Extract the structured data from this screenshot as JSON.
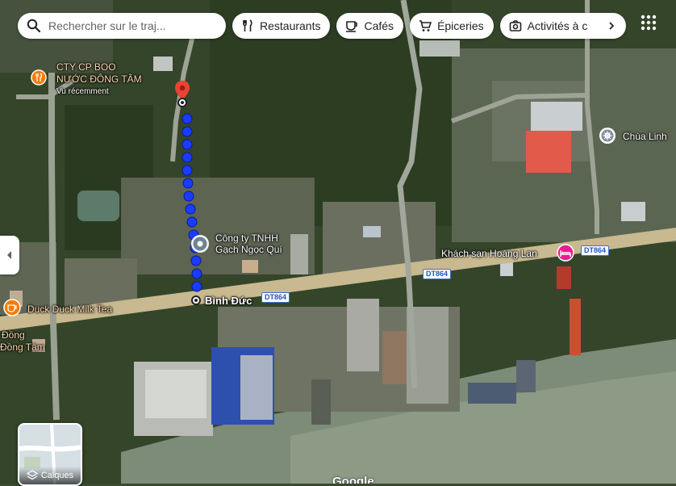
{
  "search": {
    "placeholder": "Rechercher sur le traj..."
  },
  "chips": [
    {
      "label": "Restaurants",
      "icon": "fork-knife-icon"
    },
    {
      "label": "Cafés",
      "icon": "coffee-cup-icon"
    },
    {
      "label": "Épiceries",
      "icon": "shopping-cart-icon"
    },
    {
      "label": "Activités à c",
      "icon": "camera-icon"
    }
  ],
  "places": {
    "cty_line1": "CTY CP BOO",
    "cty_line2": "NƯỚC ĐÔNG TÂM",
    "cty_sub": "Vu récemment",
    "chua": "Chùa Linh",
    "tnhh_line1": "Công ty TNHH",
    "tnhh_line2": "Gạch Ngọc Quí",
    "hotel": "Khách sạn Hoàng Lan",
    "binh_duc": "Bình Đức",
    "milk_tea": "Duck Duck Milk Tea",
    "dong_line1": "Đồng",
    "dong_line2": "Đồng Tâm"
  },
  "road_shields": [
    "DT864",
    "DT864",
    "DT864"
  ],
  "layers_label": "Calques",
  "watermark": "Google",
  "colors": {
    "route_blue": "#1a3cff",
    "pin_red": "#ea4335",
    "restaurant_orange": "#f57c00",
    "hotel_pink": "#e91e8c"
  }
}
